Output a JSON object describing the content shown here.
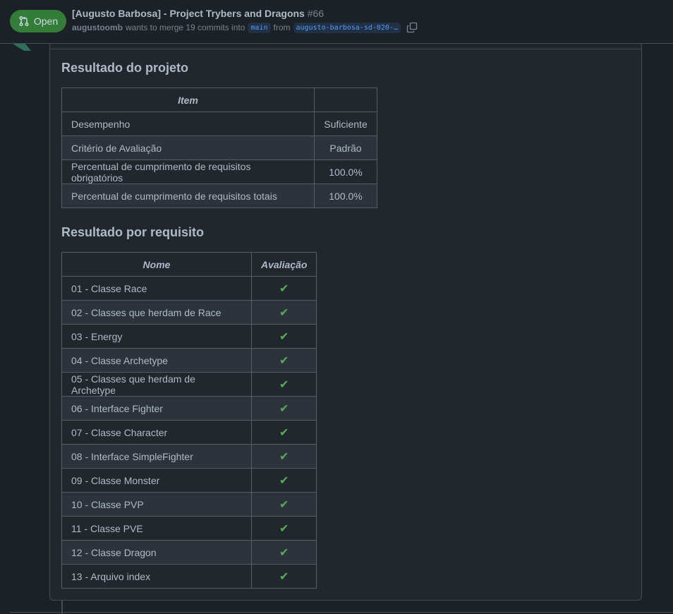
{
  "pr": {
    "status": "Open",
    "title": "[Augusto Barbosa] - Project Trybers and Dragons",
    "number": "#66",
    "author": "augustoomb",
    "merge_text": "wants to merge 19 commits into",
    "base_branch": "main",
    "from_text": "from",
    "head_branch": "augusto-barbosa-sd-020-…"
  },
  "summary": {
    "heading": "Resultado do projeto",
    "columns": [
      "Item",
      ""
    ],
    "rows": [
      [
        "Desempenho",
        "Suficiente"
      ],
      [
        "Critério de Avaliação",
        "Padrão"
      ],
      [
        "Percentual de cumprimento de requisitos obrigatórios",
        "100.0%"
      ],
      [
        "Percentual de cumprimento de requisitos totais",
        "100.0%"
      ]
    ]
  },
  "requirements": {
    "heading": "Resultado por requisito",
    "columns": [
      "Nome",
      "Avaliação"
    ],
    "rows": [
      [
        "01 - Classe Race",
        "✔"
      ],
      [
        "02 - Classes que herdam de Race",
        "✔"
      ],
      [
        "03 - Energy",
        "✔"
      ],
      [
        "04 - Classe Archetype",
        "✔"
      ],
      [
        "05 - Classes que herdam de Archetype",
        "✔"
      ],
      [
        "06 - Interface Fighter",
        "✔"
      ],
      [
        "07 - Classe Character",
        "✔"
      ],
      [
        "08 - Interface SimpleFighter",
        "✔"
      ],
      [
        "09 - Classe Monster",
        "✔"
      ],
      [
        "10 - Classe PVP",
        "✔"
      ],
      [
        "11 - Classe PVE",
        "✔"
      ],
      [
        "12 - Classe Dragon",
        "✔"
      ],
      [
        "13 - Arquivo index",
        "✔"
      ]
    ]
  },
  "icons": {
    "status": "git-pull-request-icon",
    "copy": "copy-icon",
    "check": "check-mark-icon"
  },
  "colors": {
    "open_badge": "#347d39",
    "check": "#57ab5a",
    "branch_text": "#539bf5"
  }
}
